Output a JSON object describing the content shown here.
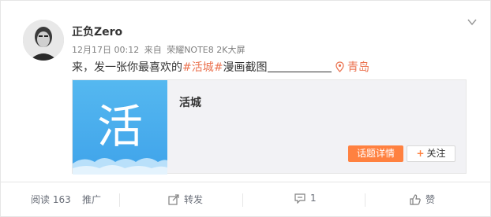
{
  "post": {
    "username": "正负Zero",
    "timestamp": "12月17日 00:12",
    "source_prefix": "来自",
    "source": "荣耀NOTE8 2K大屏",
    "text_before": "来，发一张你最喜欢的",
    "topic": "#活城#",
    "text_after": "漫画截图",
    "location": "青岛"
  },
  "topic_card": {
    "thumb_char": "活",
    "title": "活城",
    "detail_button": "话题详情",
    "follow_plus": "+",
    "follow_button": "关注"
  },
  "footer": {
    "read_label": "阅读 163",
    "promote_label": "推广",
    "repost_label": "转发",
    "comment_label": "1",
    "like_label": "赞"
  },
  "colors": {
    "accent": "#eb7350",
    "button_orange": "#ff8140",
    "thumb_blue": "#4aaeee"
  },
  "icons": [
    "chevron-down-icon",
    "avatar",
    "location-pin-icon",
    "repost-icon",
    "comment-icon",
    "like-icon"
  ]
}
